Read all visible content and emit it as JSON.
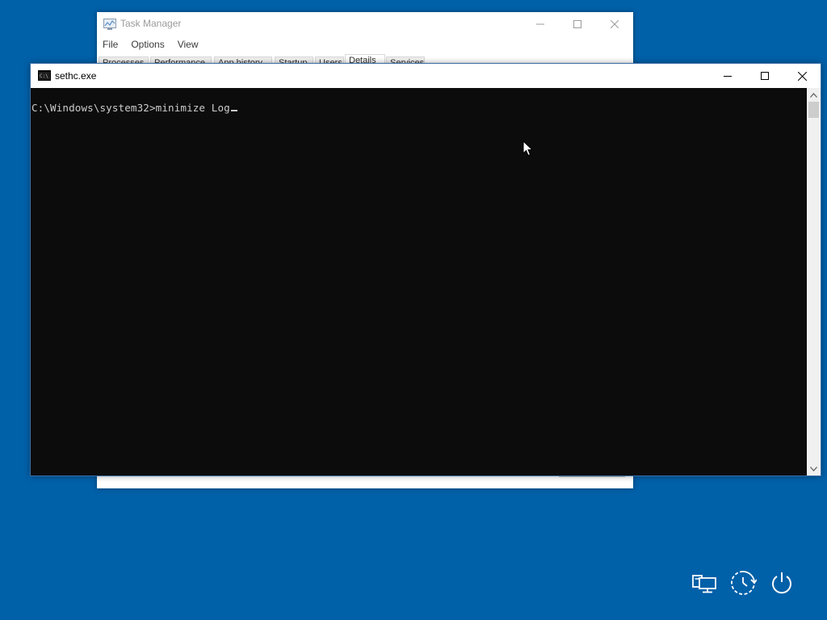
{
  "background": {
    "color": "#0060a8"
  },
  "task_manager": {
    "title": "Task Manager",
    "menu": [
      "File",
      "Options",
      "View"
    ],
    "tabs": [
      "Processes",
      "Performance",
      "App history",
      "Startup",
      "Users",
      "Details",
      "Services"
    ],
    "active_tab": "Details",
    "icon": "task-manager-icon"
  },
  "console": {
    "title": "sethc.exe",
    "icon": "console-icon",
    "prompt": "C:\\Windows\\system32>",
    "command": "minimize Log",
    "background": "#0c0c0c",
    "foreground": "#cccccc"
  },
  "logon_buttons": {
    "network": "network-icon",
    "ease_of_access": "ease-of-access-icon",
    "power": "power-icon"
  }
}
